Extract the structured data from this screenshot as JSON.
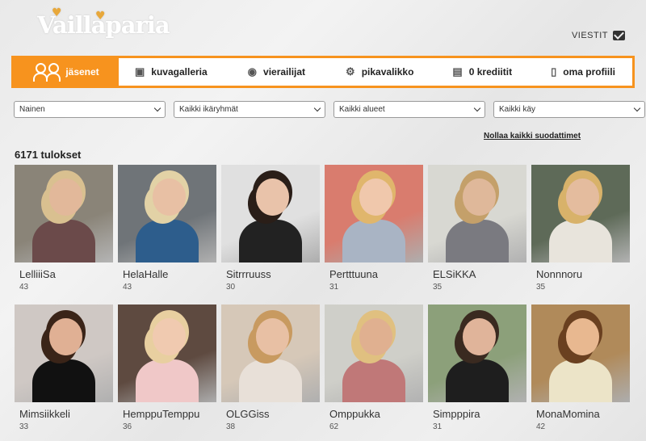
{
  "logo": "Vaillaparia",
  "messages_label": "VIESTIT",
  "nav": [
    {
      "label": "jäsenet",
      "icon": "people-icon"
    },
    {
      "label": "kuvagalleria",
      "icon": "gallery-icon"
    },
    {
      "label": "vierailijat",
      "icon": "eye-icon"
    },
    {
      "label": "pikavalikko",
      "icon": "gear-icon"
    },
    {
      "label": "0 krediitit",
      "icon": "coins-icon"
    },
    {
      "label": "oma profiili",
      "icon": "profile-icon"
    }
  ],
  "filters": [
    "Nainen",
    "Kaikki ikäryhmät",
    "Kaikki alueet",
    "Kaikki käy"
  ],
  "reset_label": "Nollaa kaikki suodattimet",
  "results_label": "6171 tulokset",
  "members": [
    {
      "name": "LelliiiSa",
      "age": "43",
      "bg": "#8a8478",
      "skin": "#e2b89a",
      "hair": "#d9c090",
      "cloth": "#6b4a4a"
    },
    {
      "name": "HelaHalle",
      "age": "43",
      "bg": "#6f7478",
      "skin": "#e8c0a4",
      "hair": "#e2d2a6",
      "cloth": "#2d5d8c"
    },
    {
      "name": "Sitrrruuss",
      "age": "30",
      "bg": "#e0e0e0",
      "skin": "#e9c3aa",
      "hair": "#2a1e18",
      "cloth": "#222222"
    },
    {
      "name": "Pertttuuna",
      "age": "31",
      "bg": "#d97c6e",
      "skin": "#f0c8ac",
      "hair": "#e0b66c",
      "cloth": "#a9b4c4"
    },
    {
      "name": "ELSiKKA",
      "age": "35",
      "bg": "#d8d8d2",
      "skin": "#dfb89a",
      "hair": "#c4a06a",
      "cloth": "#7a7a80"
    },
    {
      "name": "Nonnnoru",
      "age": "35",
      "bg": "#5e6a58",
      "skin": "#e4bc9e",
      "hair": "#d8b26a",
      "cloth": "#e8e4dc"
    },
    {
      "name": "Mimsiikkeli",
      "age": "33",
      "bg": "#cfc8c4",
      "skin": "#e0b094",
      "hair": "#3a2418",
      "cloth": "#111111"
    },
    {
      "name": "HemppuTemppu",
      "age": "36",
      "bg": "#5e4a40",
      "skin": "#f0cab0",
      "hair": "#e8cfa0",
      "cloth": "#f0c8c8"
    },
    {
      "name": "OLGGiss",
      "age": "38",
      "bg": "#d6c8b8",
      "skin": "#e8c0a4",
      "hair": "#c89a60",
      "cloth": "#e8e0d8"
    },
    {
      "name": "Omppukka",
      "age": "62",
      "bg": "#cfcfc9",
      "skin": "#e0b090",
      "hair": "#e0c080",
      "cloth": "#c07878"
    },
    {
      "name": "Simpppira",
      "age": "31",
      "bg": "#8ca07a",
      "skin": "#e0b49a",
      "hair": "#3a2a20",
      "cloth": "#1e1e1e"
    },
    {
      "name": "MonaMomina",
      "age": "42",
      "bg": "#b08a5a",
      "skin": "#e8b890",
      "hair": "#6a4020",
      "cloth": "#ece4c8"
    }
  ]
}
